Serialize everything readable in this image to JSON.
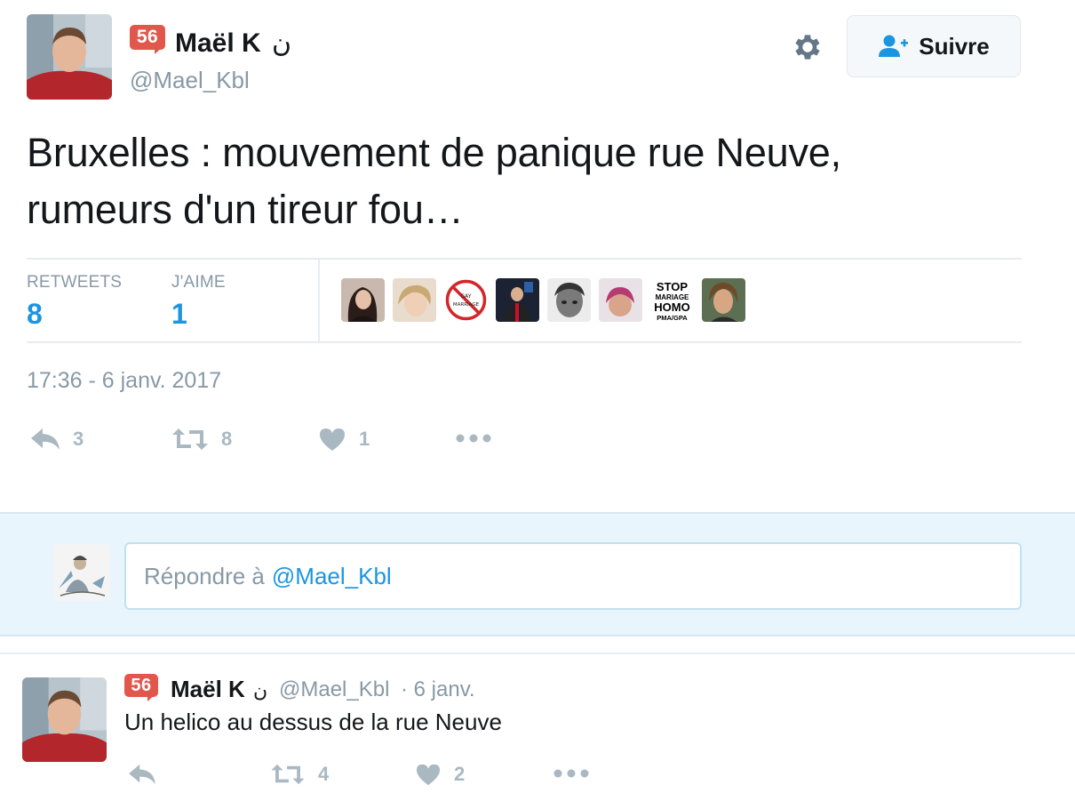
{
  "author": {
    "badge": "56",
    "name": "Maël K",
    "symbol": "ن",
    "handle": "@Mael_Kbl"
  },
  "follow_button": {
    "label": "Suivre"
  },
  "tweet": {
    "text_line1": "Bruxelles : mouvement de panique rue Neuve,",
    "text_line2": "rumeurs d'un tireur fou…",
    "stats": {
      "retweets_label": "RETWEETS",
      "retweets_value": "8",
      "likes_label": "J'AIME",
      "likes_value": "1"
    },
    "likers": [
      {
        "name": "liker-1",
        "icon": "avatar"
      },
      {
        "name": "liker-2",
        "icon": "avatar"
      },
      {
        "name": "liker-3",
        "icon": "no-gay-marriage-sign",
        "text": "GAY MARRIAGE"
      },
      {
        "name": "liker-4",
        "icon": "avatar"
      },
      {
        "name": "liker-5",
        "icon": "avatar"
      },
      {
        "name": "liker-6",
        "icon": "avatar"
      },
      {
        "name": "liker-7",
        "icon": "text-logo",
        "lines": [
          "STOP",
          "MARIAGE",
          "HOMO",
          "PMA/GPA"
        ]
      },
      {
        "name": "liker-8",
        "icon": "avatar"
      }
    ],
    "timestamp": "17:36 - 6 janv. 2017",
    "actions": {
      "reply_count": "3",
      "retweet_count": "8",
      "like_count": "1"
    }
  },
  "reply_box": {
    "placeholder_prefix": "Répondre à",
    "placeholder_handle": "@Mael_Kbl"
  },
  "reply_tweet": {
    "badge": "56",
    "name": "Maël K",
    "symbol": "ن",
    "handle": "@Mael_Kbl",
    "date": "· 6 janv.",
    "text": "Un helico au dessus de la rue Neuve",
    "actions": {
      "reply_count": "",
      "retweet_count": "4",
      "like_count": "2"
    }
  },
  "colors": {
    "accent_blue": "#1b95e0",
    "muted": "#8899a6",
    "icon_grey": "#aab8c2",
    "badge_red": "#e2574c",
    "reply_zone_bg": "#e8f5fd"
  }
}
